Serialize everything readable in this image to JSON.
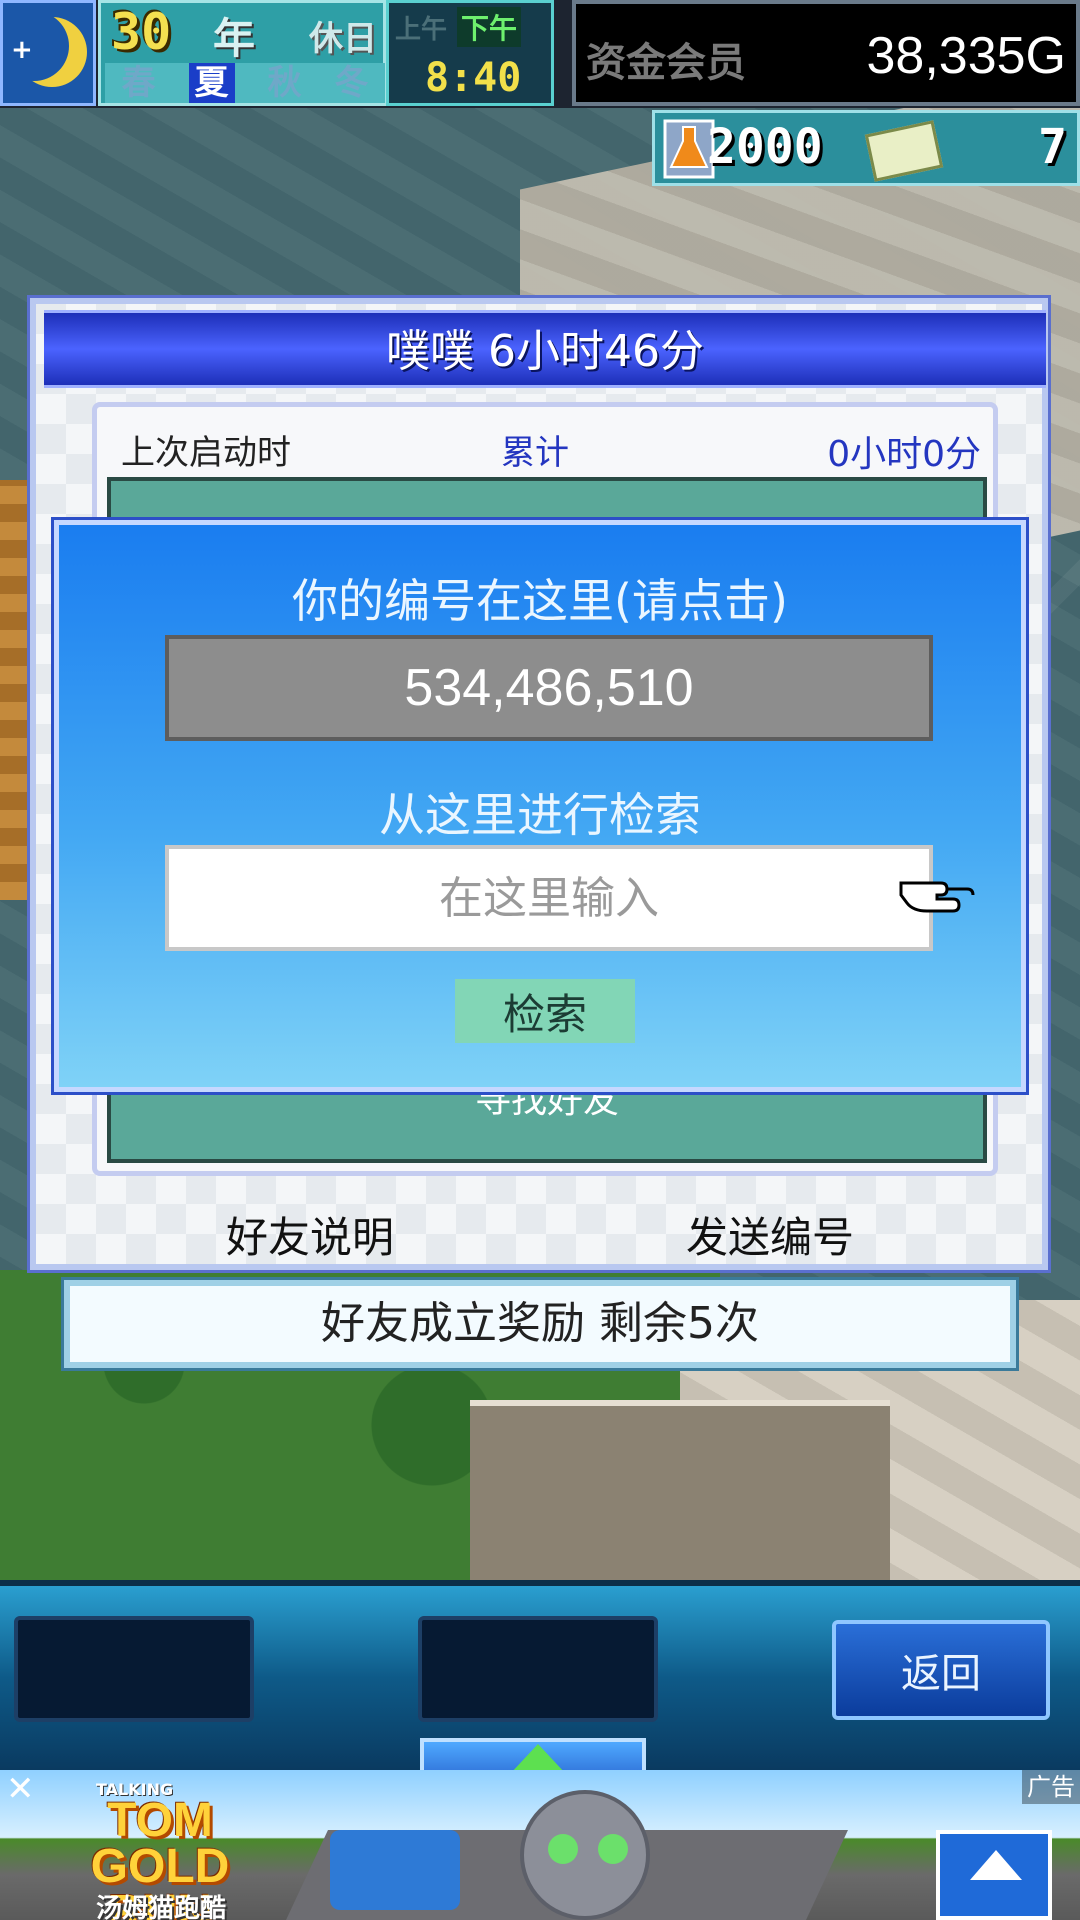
{
  "status": {
    "year": "30",
    "year_unit": "年",
    "holiday": "休日",
    "seasons": [
      "春",
      "夏",
      "秋",
      "冬"
    ],
    "active_season": "夏",
    "am": "上午",
    "pm": "下午",
    "time": "8:40",
    "funds_label": "资金会员",
    "funds": "38,335G"
  },
  "resources": {
    "research_points": "2000",
    "staff_count": "7"
  },
  "panel": {
    "title": "噗噗 6小时46分",
    "last_launch_label": "上次启动时",
    "total_label": "累计",
    "total_value": "0小时0分",
    "find_friend_label": "寻找好友",
    "friend_help": "好友说明",
    "send_number": "发送编号"
  },
  "reward": {
    "text": "好友成立奖励 剩余5次"
  },
  "dialog": {
    "id_caption": "你的编号在这里(请点击)",
    "id_value": "534,486,510",
    "search_caption": "从这里进行检索",
    "search_placeholder": "在这里输入",
    "search_button": "检索"
  },
  "bottom": {
    "back": "返回"
  },
  "ad": {
    "brand_top": "TALKING",
    "brand": "TOM GOLD RUN",
    "brand_cn": "汤姆猫跑酷",
    "label": "广告",
    "close": "✕"
  },
  "colors": {
    "dialog_blue": "#1a7df0",
    "header_blue": "#1d2fb8",
    "teal": "#5aa899",
    "funds_text": "#ffffff",
    "accent_yellow": "#f2e04a"
  },
  "icons": [
    "moon-icon",
    "flask-icon",
    "ticket-icon",
    "pointer-hand-icon",
    "up-arrow-icon",
    "close-icon"
  ]
}
